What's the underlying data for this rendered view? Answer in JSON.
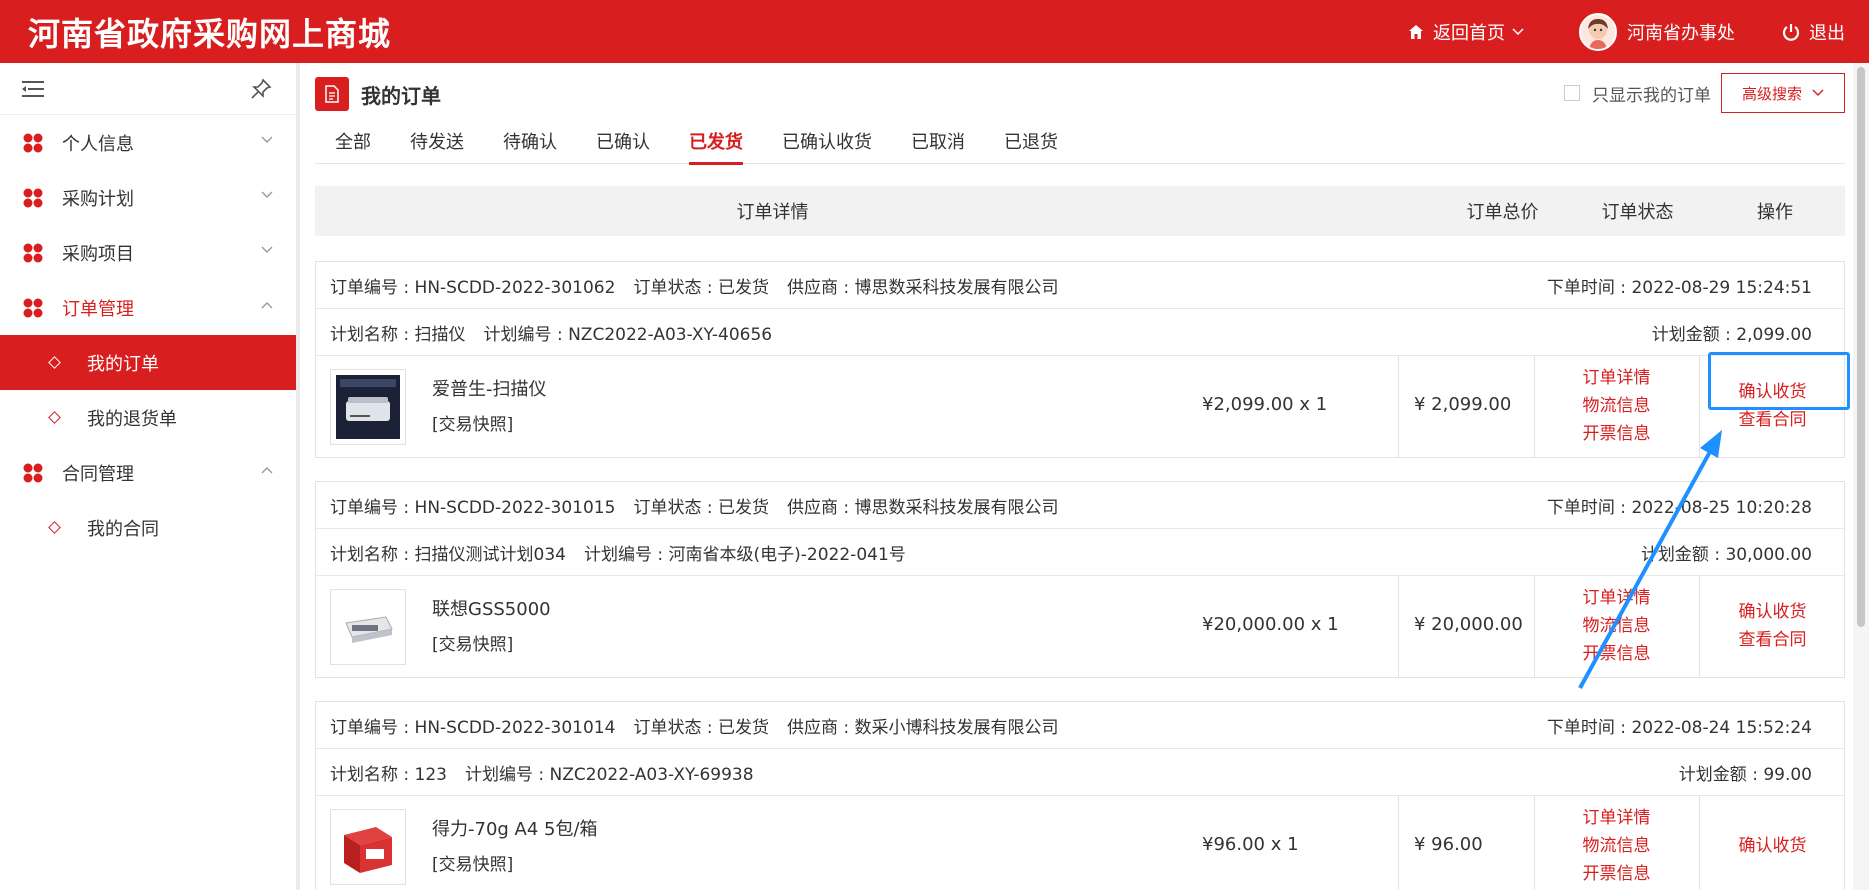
{
  "header": {
    "logo": "河南省政府采购网上商城",
    "home_label": "返回首页",
    "user_label": "河南省办事处",
    "logout_label": "退出"
  },
  "sidebar": {
    "items": [
      {
        "label": "个人信息"
      },
      {
        "label": "采购计划"
      },
      {
        "label": "采购项目"
      },
      {
        "label": "订单管理",
        "sub": [
          {
            "label": "我的订单"
          },
          {
            "label": "我的退货单"
          }
        ]
      },
      {
        "label": "合同管理",
        "sub": [
          {
            "label": "我的合同"
          }
        ]
      }
    ]
  },
  "main": {
    "title": "我的订单",
    "only_mine_label": "只显示我的订单",
    "advanced_search_label": "高级搜索",
    "tabs": [
      "全部",
      "待发送",
      "待确认",
      "已确认",
      "已发货",
      "已确认收货",
      "已取消",
      "已退货"
    ],
    "active_tab": "已发货",
    "columns": [
      "订单详情",
      "订单总价",
      "订单状态",
      "操作"
    ]
  },
  "orders": [
    {
      "order_no": "订单编号 : HN-SCDD-2022-301062",
      "status": "订单状态 : 已发货",
      "supplier": "供应商 : 博思数采科技发展有限公司",
      "time": "下单时间 : 2022-08-29 15:24:51",
      "plan_name": "计划名称 : 扫描仪",
      "plan_no": "计划编号 : NZC2022-A03-XY-40656",
      "plan_amount": "计划金额 : 2,099.00",
      "product": "爱普生-扫描仪",
      "snapshot": "[交易快照]",
      "unit": "¥2,099.00 x 1",
      "total": "¥  2,099.00",
      "links": [
        "订单详情",
        "物流信息",
        "开票信息"
      ],
      "actions": [
        "确认收货",
        "查看合同"
      ]
    },
    {
      "order_no": "订单编号 : HN-SCDD-2022-301015",
      "status": "订单状态 : 已发货",
      "supplier": "供应商 : 博思数采科技发展有限公司",
      "time": "下单时间 : 2022-08-25 10:20:28",
      "plan_name": "计划名称 : 扫描仪测试计划034",
      "plan_no": "计划编号 : 河南省本级(电子)-2022-041号",
      "plan_amount": "计划金额 : 30,000.00",
      "product": "联想GSS5000",
      "snapshot": "[交易快照]",
      "unit": "¥20,000.00 x 1",
      "total": "¥  20,000.00",
      "links": [
        "订单详情",
        "物流信息",
        "开票信息"
      ],
      "actions": [
        "确认收货",
        "查看合同"
      ]
    },
    {
      "order_no": "订单编号 : HN-SCDD-2022-301014",
      "status": "订单状态 : 已发货",
      "supplier": "供应商 : 数采小博科技发展有限公司",
      "time": "下单时间 : 2022-08-24 15:52:24",
      "plan_name": "计划名称 : 123",
      "plan_no": "计划编号 : NZC2022-A03-XY-69938",
      "plan_amount": "计划金额 : 99.00",
      "product": "得力-70g A4 5包/箱",
      "snapshot": "[交易快照]",
      "unit": "¥96.00 x 1",
      "total": "¥  96.00",
      "links": [
        "订单详情",
        "物流信息",
        "开票信息"
      ],
      "actions": [
        "确认收货"
      ]
    }
  ],
  "colors": {
    "brand_red": "#d81e1e",
    "highlight_blue": "#1e90ff"
  }
}
